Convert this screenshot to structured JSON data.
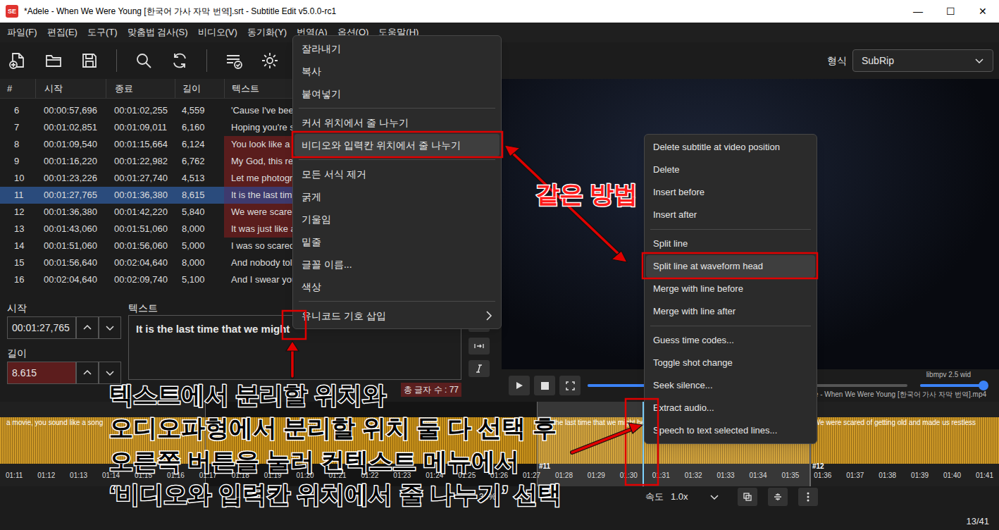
{
  "window": {
    "app_icon": "SE",
    "title": "*Adele - When We Were Young [한국어 가사 자막 번역].srt - Subtitle Edit v5.0.0-rc1",
    "controls": [
      "—",
      "☐",
      "✕"
    ]
  },
  "menubar": [
    "파일(F)",
    "편집(E)",
    "도구(T)",
    "맞춤법 검사(S)",
    "비디오(V)",
    "동기화(Y)",
    "번역(A)",
    "옵션(O)",
    "도움말(H)"
  ],
  "toolbar": {
    "format_label": "형식",
    "format_value": "SubRip"
  },
  "grid": {
    "columns": [
      "#",
      "시작",
      "종료",
      "길이",
      "텍스트"
    ],
    "rows": [
      {
        "cells": [
          "6",
          "00:00:57,696",
          "00:01:02,255",
          "4,559",
          "'Cause I've been"
        ],
        "selected": false,
        "warn": false
      },
      {
        "cells": [
          "7",
          "00:01:02,851",
          "00:01:09,011",
          "6,160",
          "Hoping you're s"
        ],
        "selected": false,
        "warn": false
      },
      {
        "cells": [
          "8",
          "00:01:09,540",
          "00:01:15,664",
          "6,124",
          "You look like a"
        ],
        "selected": false,
        "warn": true
      },
      {
        "cells": [
          "9",
          "00:01:16,220",
          "00:01:22,982",
          "6,762",
          "My God, this re"
        ],
        "selected": false,
        "warn": true
      },
      {
        "cells": [
          "10",
          "00:01:23,226",
          "00:01:27,740",
          "4,513",
          "Let me photogr"
        ],
        "selected": false,
        "warn": true
      },
      {
        "cells": [
          "11",
          "00:01:27,765",
          "00:01:36,380",
          "8,615",
          "It is the last tim"
        ],
        "selected": true,
        "warn": true
      },
      {
        "cells": [
          "12",
          "00:01:36,380",
          "00:01:42,220",
          "5,840",
          "We were scared"
        ],
        "selected": false,
        "warn": true
      },
      {
        "cells": [
          "13",
          "00:01:43,060",
          "00:01:51,060",
          "8,000",
          "It was just like a"
        ],
        "selected": false,
        "warn": true
      },
      {
        "cells": [
          "14",
          "00:01:51,060",
          "00:01:56,060",
          "5,000",
          "I was so scared"
        ],
        "selected": false,
        "warn": false
      },
      {
        "cells": [
          "15",
          "00:01:56,640",
          "00:02:04,640",
          "8,000",
          "And nobody tol"
        ],
        "selected": false,
        "warn": false
      },
      {
        "cells": [
          "16",
          "00:02:04,640",
          "00:02:09,740",
          "5,100",
          "And I swear you"
        ],
        "selected": false,
        "warn": false
      }
    ]
  },
  "editor": {
    "start": {
      "label": "시작",
      "value": "00:01:27,765"
    },
    "duration": {
      "label": "길이",
      "value": "8.615",
      "warn": true
    },
    "text": {
      "label": "텍스트",
      "value": "It is the last time that we might"
    },
    "char_count": "총 글자 수 : 77"
  },
  "video": {
    "player": "libmpv 2.5 wid",
    "file": "dele - When We Were Young [한국어 가사 자막 번역].mp4",
    "position_level": 0.34,
    "volume_level": 1
  },
  "waveform": {
    "segments": [
      {
        "label": "a movie, you sound like a song",
        "selected": false
      },
      {
        "label": "It is the last time that we might be",
        "selected": true
      },
      {
        "label": "We were scared of getting old and made us restless",
        "selected": false
      }
    ],
    "markers": [
      "#11",
      "#12"
    ],
    "ticks": [
      "01:11",
      "01:12",
      "01:13",
      "01:14",
      "01:15",
      "01:16",
      "01:17",
      "01:18",
      "01:19",
      "01:20",
      "01:21",
      "01:22",
      "01:23",
      "01:24",
      "01:25",
      "01:26",
      "01:27",
      "01:28",
      "01:29",
      "01:30",
      "01:31",
      "01:32",
      "01:33",
      "01:34",
      "01:35",
      "01:36",
      "01:37",
      "01:38",
      "01:39",
      "01:40",
      "01:41"
    ]
  },
  "bottom_bar": {
    "zoom": "30%",
    "speed_label": "속도",
    "speed_value": "1.0x",
    "counter": "13/41"
  },
  "text_menu": {
    "groups": [
      [
        {
          "label": "잘라내기",
          "highlighted": false,
          "submenu": false
        },
        {
          "label": "복사",
          "highlighted": false,
          "submenu": false
        },
        {
          "label": "붙여넣기",
          "highlighted": false,
          "submenu": false
        }
      ],
      [
        {
          "label": "커서 위치에서 줄 나누기",
          "highlighted": false,
          "submenu": false
        },
        {
          "label": "비디오와 입력칸 위치에서 줄 나누기",
          "highlighted": true,
          "submenu": false
        }
      ],
      [
        {
          "label": "모든 서식 제거",
          "highlighted": false,
          "submenu": false
        },
        {
          "label": "굵게",
          "highlighted": false,
          "submenu": false
        },
        {
          "label": "기울임",
          "highlighted": false,
          "submenu": false
        },
        {
          "label": "밑줄",
          "highlighted": false,
          "submenu": false
        },
        {
          "label": "글꼴 이름...",
          "highlighted": false,
          "submenu": false
        },
        {
          "label": "색상",
          "highlighted": false,
          "submenu": false
        }
      ],
      [
        {
          "label": "유니코드 기호 삽입",
          "highlighted": false,
          "submenu": true
        }
      ]
    ]
  },
  "waveform_menu": {
    "groups": [
      [
        {
          "label": "Delete subtitle at video position",
          "highlighted": false,
          "submenu": false
        },
        {
          "label": "Delete",
          "highlighted": false,
          "submenu": false
        },
        {
          "label": "Insert before",
          "highlighted": false,
          "submenu": false
        },
        {
          "label": "Insert after",
          "highlighted": false,
          "submenu": false
        }
      ],
      [
        {
          "label": "Split line",
          "highlighted": false,
          "submenu": false
        },
        {
          "label": "Split line at waveform head",
          "highlighted": true,
          "submenu": false
        },
        {
          "label": "Merge with line before",
          "highlighted": false,
          "submenu": false
        },
        {
          "label": "Merge with line after",
          "highlighted": false,
          "submenu": false
        }
      ],
      [
        {
          "label": "Guess time codes...",
          "highlighted": false,
          "submenu": false
        },
        {
          "label": "Toggle shot change",
          "highlighted": false,
          "submenu": false
        },
        {
          "label": "Seek silence...",
          "highlighted": false,
          "submenu": false
        },
        {
          "label": "Extract audio...",
          "highlighted": false,
          "submenu": false
        },
        {
          "label": "Speech to text selected lines...",
          "highlighted": false,
          "submenu": false
        }
      ]
    ]
  },
  "annotations": {
    "label": "같은 방법",
    "instructions": [
      "텍스트에서 분리할 위치와",
      "오디오파형에서 분리할 위치 둘 다 선택 후",
      "오른쪽 버튼을 눌러 컨텍스트 메뉴에서",
      "‘비디오와 입력칸 위치에서 줄 나누기’ 선택"
    ]
  }
}
